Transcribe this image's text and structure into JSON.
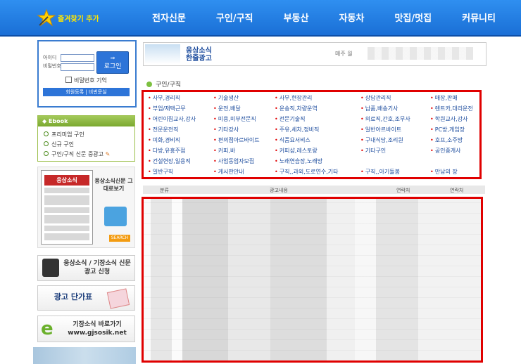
{
  "header": {
    "favorite_label": "즐겨찾기 추가",
    "nav": [
      "전자신문",
      "구인/구직",
      "부동산",
      "자동차",
      "맛집/멋집",
      "커뮤니티"
    ]
  },
  "login": {
    "id_label": "아이디",
    "pw_label": "비밀번호",
    "button_label": "로그인",
    "remember_label": "비밀번호 기억",
    "signup_label": "회원등록",
    "find_label": "비번문실"
  },
  "ebook": {
    "title": "Ebook",
    "items": [
      "프리미엄 구인",
      "신규 구인",
      "구인/구직 신문 중광고"
    ]
  },
  "paper_promo": {
    "thumb_title": "웅상소식",
    "caption": "웅상소식신문 그대로보기",
    "search_label": "SEARCH"
  },
  "banners": {
    "apply": "웅상소식 / 기장소식 신문광고 신청",
    "price": "광고 단가표",
    "gjsosik": "기장소식 바로가기 www.gjsosik.net"
  },
  "ad_header": {
    "title_line1": "웅상소식",
    "title_line2": "한줄광고",
    "date_prefix": "매주 월"
  },
  "section_title": "구인/구직",
  "categories": [
    "사무,경리직",
    "기술생산",
    "사무,현장관리",
    "상담관리직",
    "매장,판매",
    "부업/재택근무",
    "운전,배달",
    "운송직,차량운역",
    "납품,배송기사",
    "렌트카,대리운전",
    "어린이집교사,강사",
    "미용,미부전문직",
    "전문기술직",
    "의료직,간호,조무사",
    "학원교사,강사",
    "전문운전직",
    "기타강사",
    "주유,세차,정비직",
    "일반아르바이트",
    "PC방,게임장",
    "미화,경비직",
    "편의점아르바이트",
    "식품요서비스",
    "구내식당,조리원",
    "호프,소주방",
    "다방,유흥주점",
    "커피,바",
    "커피샵,레스토랑",
    "기타구인",
    "공인중개사",
    "건설현장,일용직",
    "사업동업자모집",
    "노래연습장,노래방",
    "",
    "",
    "일반구직",
    "게시판안내",
    "구직,,과외,도로연수,기타",
    "구직,,아기돌봄",
    "만남의 장"
  ],
  "table_headers": [
    "분류",
    "광고내용",
    "연락처",
    "연락처"
  ]
}
